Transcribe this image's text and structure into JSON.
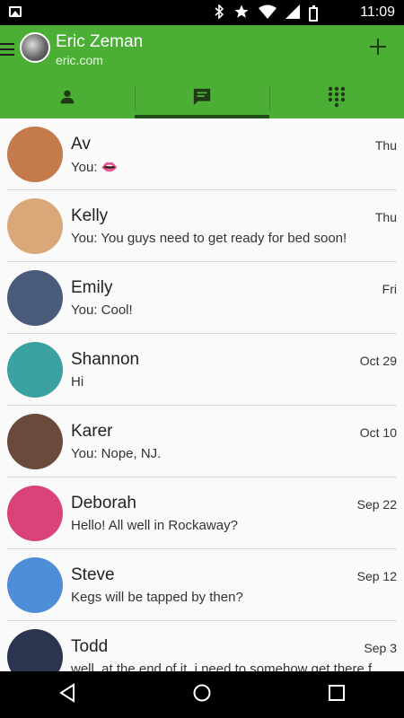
{
  "status_bar": {
    "time": "11:09",
    "icons": [
      "bluetooth-icon",
      "star-icon",
      "wifi-icon",
      "signal-icon",
      "battery-icon"
    ]
  },
  "header": {
    "name": "Eric Zeman",
    "email": "eric.com",
    "add_icon": "plus-icon",
    "menu_icon": "hamburger-icon",
    "background": "#4caf35"
  },
  "tabs": [
    {
      "icon": "person-icon",
      "active": false
    },
    {
      "icon": "message-icon",
      "active": true
    },
    {
      "icon": "dialpad-icon",
      "active": false
    }
  ],
  "conversations": [
    {
      "name": "Av",
      "snippet": "You: 👄",
      "date": "Thu",
      "avatar_color": "#c47a4a"
    },
    {
      "name": "Kelly",
      "snippet": "You: You guys need to get ready for bed soon!",
      "date": "Thu",
      "avatar_color": "#d8a878"
    },
    {
      "name": "Emily",
      "snippet": "You: Cool!",
      "date": "Fri",
      "avatar_color": "#4a5a7a"
    },
    {
      "name": "Shannon",
      "snippet": "Hi",
      "date": "Oct 29",
      "avatar_color": "#3aa0a0"
    },
    {
      "name": "Karer",
      "snippet": "You: Nope, NJ.",
      "date": "Oct 10",
      "avatar_color": "#6a4a3a"
    },
    {
      "name": "Deborah",
      "snippet": "Hello! All well in Rockaway?",
      "date": "Sep 22",
      "avatar_color": "#d9437a"
    },
    {
      "name": "Steve",
      "snippet": "Kegs will be tapped by then?",
      "date": "Sep 12",
      "avatar_color": "#4e8ed8"
    },
    {
      "name": "Todd",
      "snippet": "well, at the end of it, i need to somehow get there f",
      "date": "Sep 3",
      "avatar_color": "#2a3550"
    }
  ],
  "nav": [
    "back-icon",
    "home-icon",
    "recents-icon"
  ]
}
